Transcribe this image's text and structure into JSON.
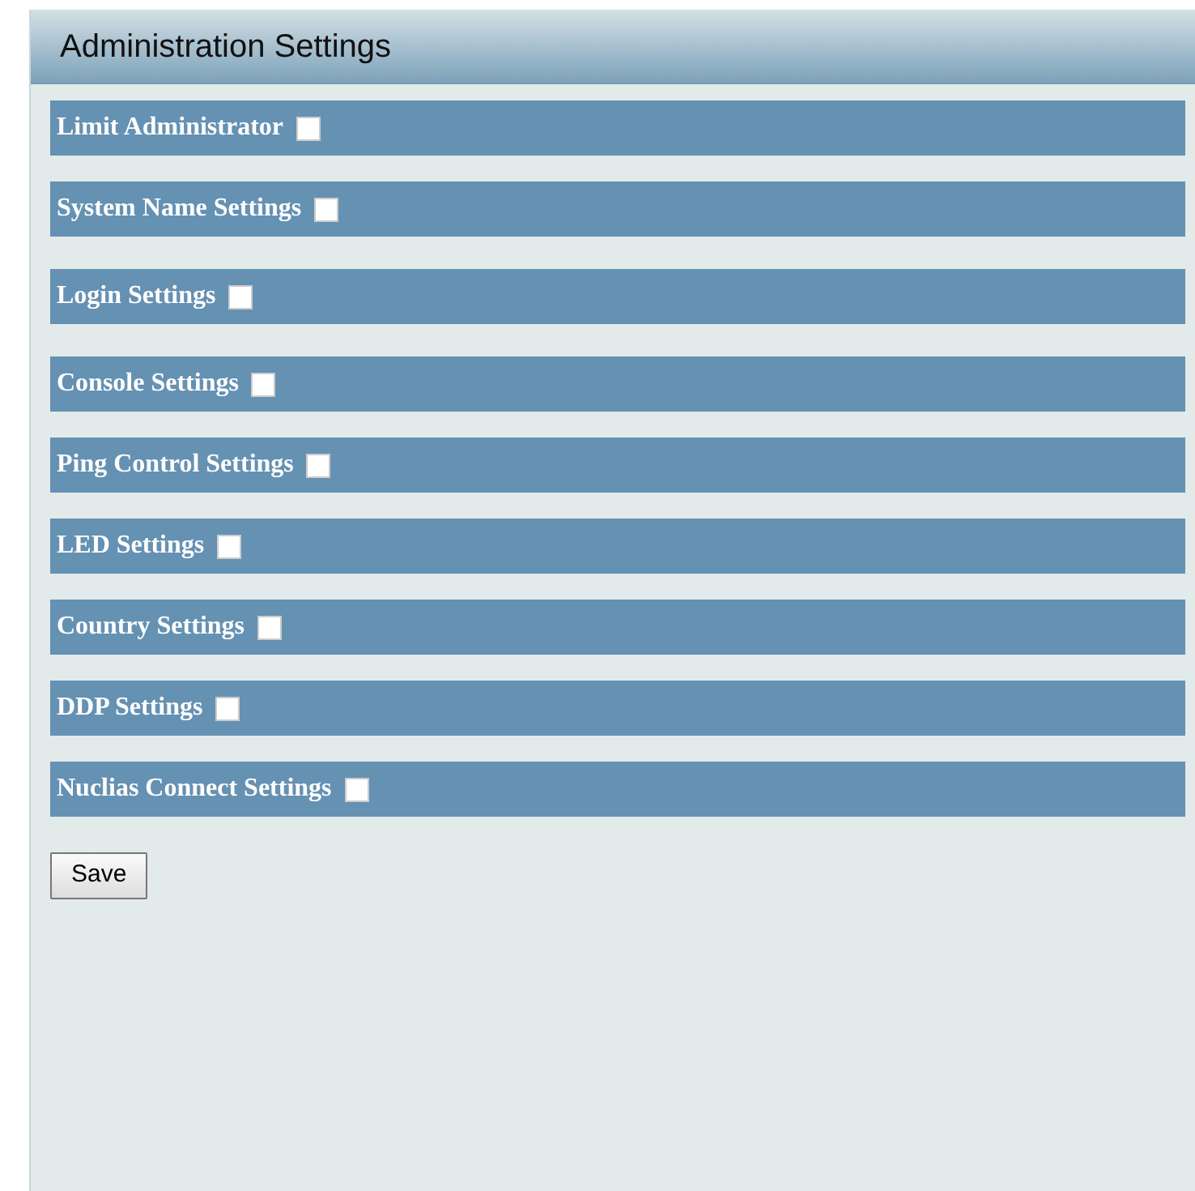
{
  "panel": {
    "title": "Administration Settings"
  },
  "sections": [
    {
      "label": "Limit Administrator",
      "checked": false
    },
    {
      "label": "System Name Settings",
      "checked": false
    },
    {
      "label": "Login Settings",
      "checked": false
    },
    {
      "label": "Console Settings",
      "checked": false
    },
    {
      "label": "Ping Control Settings",
      "checked": false
    },
    {
      "label": "LED Settings",
      "checked": false
    },
    {
      "label": "Country Settings",
      "checked": false
    },
    {
      "label": "DDP Settings",
      "checked": false
    },
    {
      "label": "Nuclias Connect Settings",
      "checked": false
    }
  ],
  "buttons": [
    "Save"
  ]
}
